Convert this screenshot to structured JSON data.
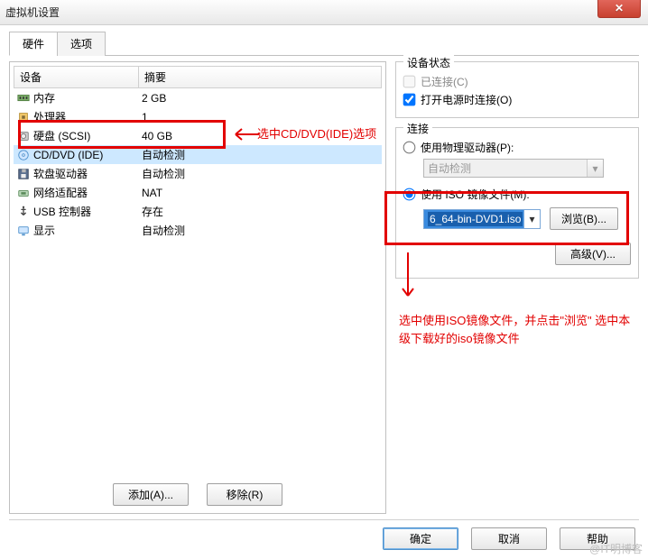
{
  "window": {
    "title": "虚拟机设置"
  },
  "tabs": {
    "hardware": "硬件",
    "options": "选项"
  },
  "list": {
    "header_device": "设备",
    "header_summary": "摘要",
    "rows": [
      {
        "name": "内存",
        "summary": "2 GB",
        "icon": "memory-icon"
      },
      {
        "name": "处理器",
        "summary": "1",
        "icon": "cpu-icon"
      },
      {
        "name": "硬盘 (SCSI)",
        "summary": "40 GB",
        "icon": "disk-icon"
      },
      {
        "name": "CD/DVD (IDE)",
        "summary": "自动检测",
        "icon": "cd-icon",
        "selected": true
      },
      {
        "name": "软盘驱动器",
        "summary": "自动检测",
        "icon": "floppy-icon"
      },
      {
        "name": "网络适配器",
        "summary": "NAT",
        "icon": "net-icon"
      },
      {
        "name": "USB 控制器",
        "summary": "存在",
        "icon": "usb-icon"
      },
      {
        "name": "显示",
        "summary": "自动检测",
        "icon": "display-icon"
      }
    ]
  },
  "buttons": {
    "add": "添加(A)...",
    "remove": "移除(R)",
    "ok": "确定",
    "cancel": "取消",
    "help": "帮助",
    "browse": "浏览(B)...",
    "advanced": "高级(V)..."
  },
  "status_group": {
    "legend": "设备状态",
    "connected": "已连接(C)",
    "connect_poweron": "打开电源时连接(O)",
    "connected_checked": false,
    "poweron_checked": true
  },
  "connection_group": {
    "legend": "连接",
    "physical": "使用物理驱动器(P):",
    "physical_selected": false,
    "physical_combo": "自动检测",
    "iso": "使用 ISO 镜像文件(M):",
    "iso_selected": true,
    "iso_file": "6_64-bin-DVD1.iso"
  },
  "annotations": {
    "a1": "选中CD/DVD(IDE)选项",
    "a2": "选中使用ISO镜像文件，并点击\"浏览\"  选中本级下载好的iso镜像文件"
  },
  "watermark": "@IT明博客"
}
